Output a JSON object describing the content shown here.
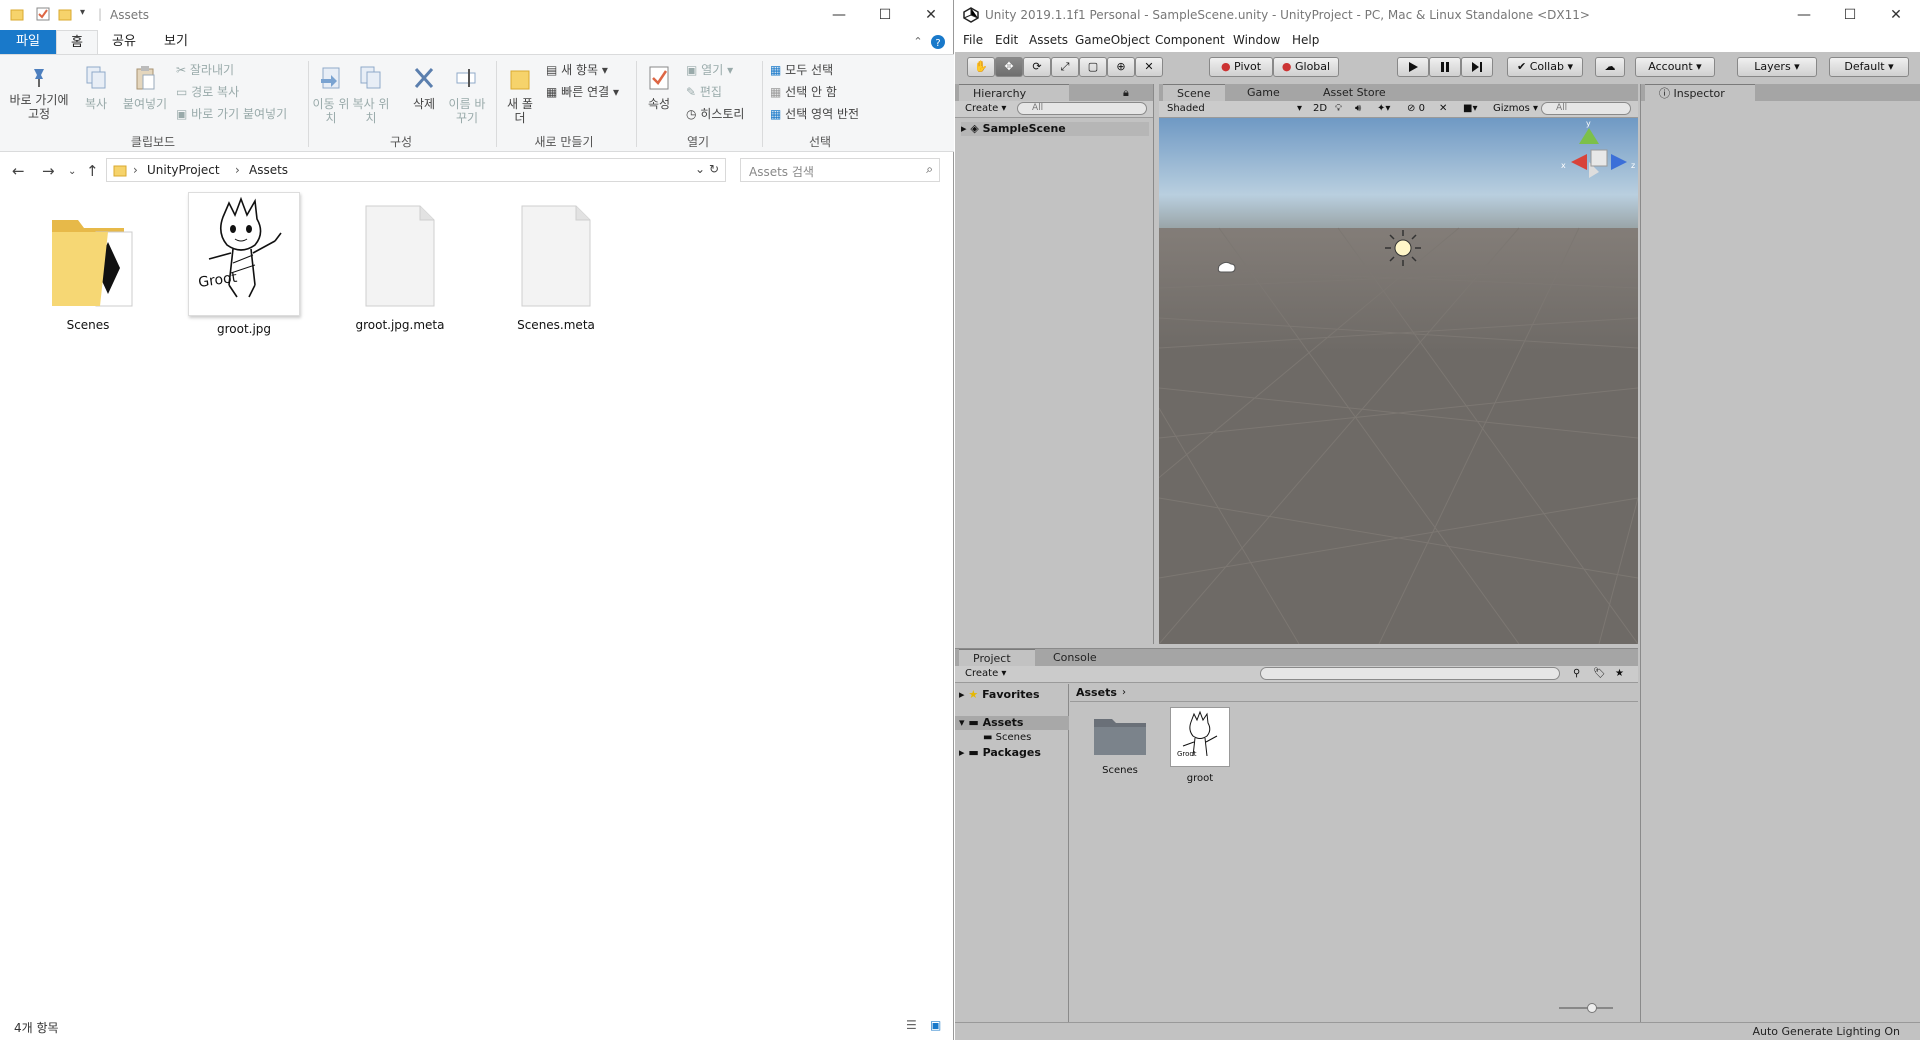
{
  "explorer": {
    "title": "Assets",
    "window_controls": {
      "minimize": "—",
      "maximize": "☐",
      "close": "✕"
    },
    "tabs": [
      "파일",
      "홈",
      "공유",
      "보기"
    ],
    "ribbon": {
      "pin": "바로 가기에 고정",
      "copy": "복사",
      "paste": "붙여넣기",
      "cut": "잘라내기",
      "copy_path": "경로 복사",
      "paste_shortcut": "바로 가기 붙여넣기",
      "clipboard_group": "클립보드",
      "move_to": "이동 위치",
      "copy_to": "복사 위치",
      "delete": "삭제",
      "rename": "이름 바꾸기",
      "organize_group": "구성",
      "new_folder": "새 폴더",
      "new_item": "새 항목",
      "easy_access": "빠른 연결",
      "new_group": "새로 만들기",
      "properties": "속성",
      "open": "열기",
      "edit": "편집",
      "history": "히스토리",
      "open_group": "열기",
      "select_all": "모두 선택",
      "select_none": "선택 안 함",
      "invert_selection": "선택 영역 반전",
      "select_group": "선택"
    },
    "address": {
      "crumbs": [
        "UnityProject",
        "Assets"
      ]
    },
    "search_placeholder": "Assets 검색",
    "files": [
      {
        "name": "Scenes",
        "type": "folder"
      },
      {
        "name": "groot.jpg",
        "type": "image"
      },
      {
        "name": "groot.jpg.meta",
        "type": "file"
      },
      {
        "name": "Scenes.meta",
        "type": "file"
      }
    ],
    "status": "4개 항목"
  },
  "unity": {
    "title": "Unity 2019.1.1f1 Personal - SampleScene.unity - UnityProject - PC, Mac & Linux Standalone <DX11>",
    "menu": [
      "File",
      "Edit",
      "Assets",
      "GameObject",
      "Component",
      "Window",
      "Help"
    ],
    "toolbar": {
      "pivot": "Pivot",
      "global": "Global",
      "collab": "Collab ▾",
      "account": "Account",
      "layers": "Layers",
      "layout": "Default"
    },
    "hierarchy": {
      "tab": "Hierarchy",
      "create": "Create ▾",
      "search": "All",
      "scene": "SampleScene"
    },
    "scene": {
      "tabs": [
        "Scene",
        "Game",
        "Asset Store"
      ],
      "shading": "Shaded",
      "mode2d": "2D",
      "fx_count": "0",
      "gizmos": "Gizmos",
      "search": "All",
      "axis_labels": {
        "y": "y",
        "x": "x",
        "z": "z"
      },
      "colors": {
        "sky_top": "#6f99c4",
        "horizon": "#9aa5a8",
        "ground": "#6e6a66"
      }
    },
    "inspector": {
      "tab": "Inspector"
    },
    "project": {
      "tabs": [
        "Project",
        "Console"
      ],
      "create": "Create ▾",
      "favorites": "Favorites",
      "tree": [
        "Assets",
        "Scenes",
        "Packages"
      ],
      "breadcrumb": "Assets",
      "assets": [
        {
          "name": "Scenes",
          "type": "folder"
        },
        {
          "name": "groot",
          "type": "image"
        }
      ]
    },
    "status": "Auto Generate Lighting On"
  }
}
